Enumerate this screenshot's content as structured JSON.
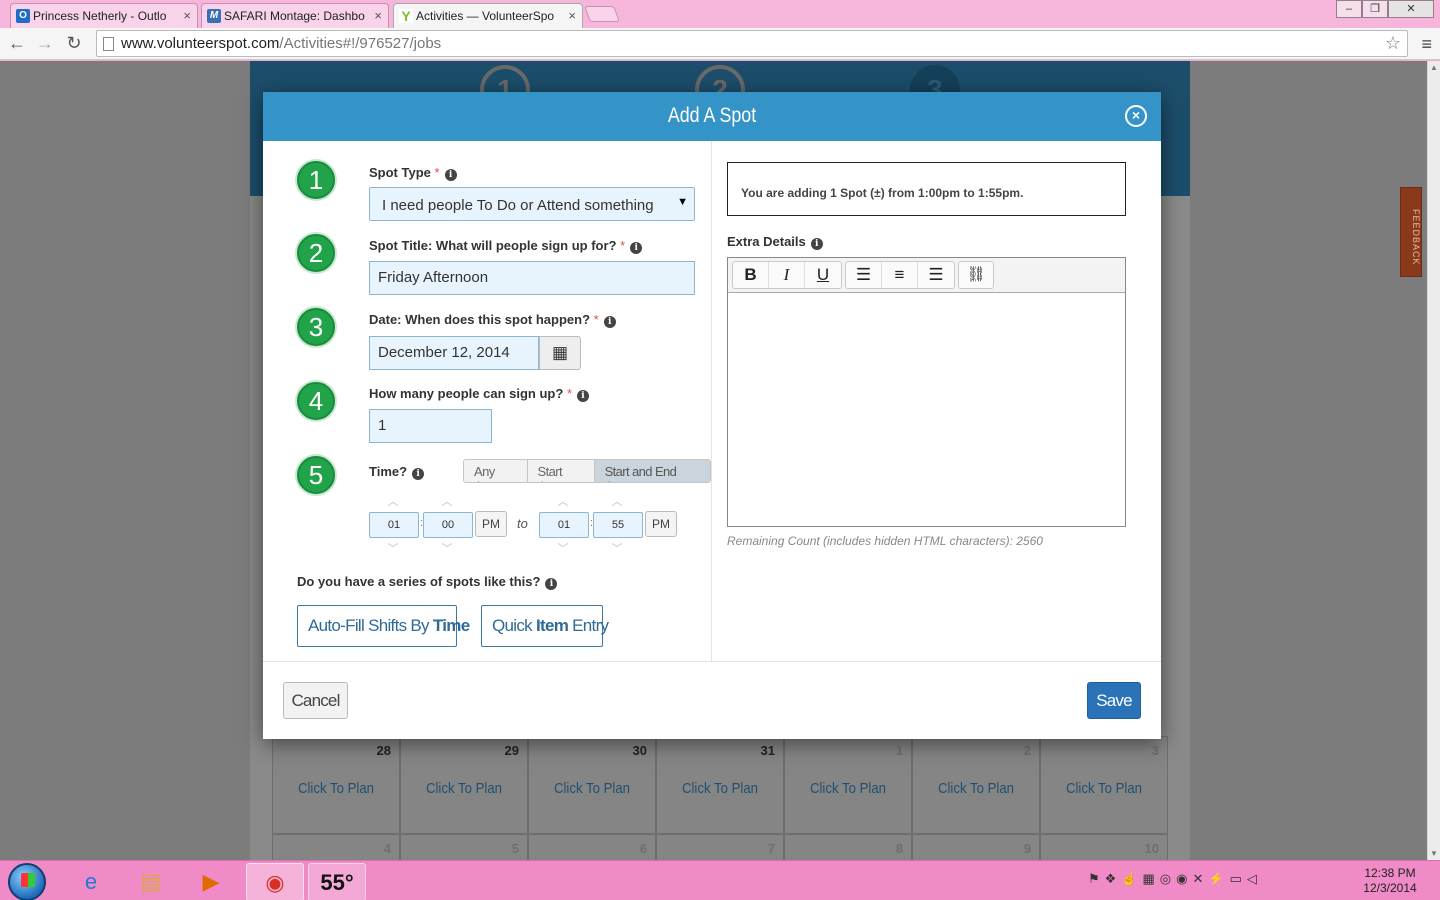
{
  "browser": {
    "tabs": [
      {
        "label": "Princess Netherly - Outlo",
        "icon": "outlook-icon"
      },
      {
        "label": "SAFARI Montage: Dashbo",
        "icon": "safari-montage-icon"
      },
      {
        "label": "Activities — VolunteerSpo",
        "icon": "volunteerspot-icon"
      }
    ],
    "url_host": "www.volunteerspot.com",
    "url_path": "/Activities#!/976527/jobs"
  },
  "background": {
    "steps": [
      "1",
      "2",
      "3"
    ],
    "feedback": "FEEDBACK",
    "calendar_row1": [
      {
        "date": "28",
        "action": "Click To Plan",
        "muted": false
      },
      {
        "date": "29",
        "action": "Click To Plan",
        "muted": false
      },
      {
        "date": "30",
        "action": "Click To Plan",
        "muted": false
      },
      {
        "date": "31",
        "action": "Click To Plan",
        "muted": false
      },
      {
        "date": "1",
        "action": "Click To Plan",
        "muted": true
      },
      {
        "date": "2",
        "action": "Click To Plan",
        "muted": true
      },
      {
        "date": "3",
        "action": "Click To Plan",
        "muted": true
      }
    ],
    "calendar_row2": [
      "4",
      "5",
      "6",
      "7",
      "8",
      "9",
      "10"
    ]
  },
  "modal": {
    "title": "Add A Spot",
    "step_numbers": [
      "1",
      "2",
      "3",
      "4",
      "5"
    ],
    "spot_type_label": "Spot Type",
    "spot_type_value": "I need people To Do or Attend something",
    "spot_title_label": "Spot Title: What will people sign up for?",
    "spot_title_value": "Friday Afternoon",
    "date_label": "Date: When does this spot happen?",
    "date_value": "December 12, 2014",
    "count_label": "How many people can sign up?",
    "count_value": "1",
    "time_label": "Time?",
    "time_modes": [
      "Any time",
      "Start time",
      "Start and End times"
    ],
    "time_mode_selected": "Start and End times",
    "start_hour": "01",
    "start_min": "00",
    "start_ampm": "PM",
    "to_label": "to",
    "end_hour": "01",
    "end_min": "55",
    "end_ampm": "PM",
    "required_mark": "*",
    "series_label": "Do you have a series of spots like this?",
    "autofill_prefix": "Auto-Fill Shifts By ",
    "autofill_bold": "Time",
    "quick_prefix": "Quick ",
    "quick_bold": "Item",
    "quick_suffix": " Entry",
    "summary": "You are adding 1 Spot (±) from 1:00pm to 1:55pm.",
    "extra_label": "Extra Details",
    "editor_buttons": [
      "B",
      "I",
      "U"
    ],
    "remaining": "Remaining Count (includes hidden HTML characters): 2560",
    "cancel": "Cancel",
    "save": "Save"
  },
  "taskbar": {
    "weather": "55°",
    "time": "12:38 PM",
    "date": "12/3/2014"
  },
  "colors": {
    "modal_header": "#3494c8",
    "step_green": "#21a34a",
    "save_blue": "#2a73b8",
    "taskbar_pink": "#f08bc7"
  }
}
